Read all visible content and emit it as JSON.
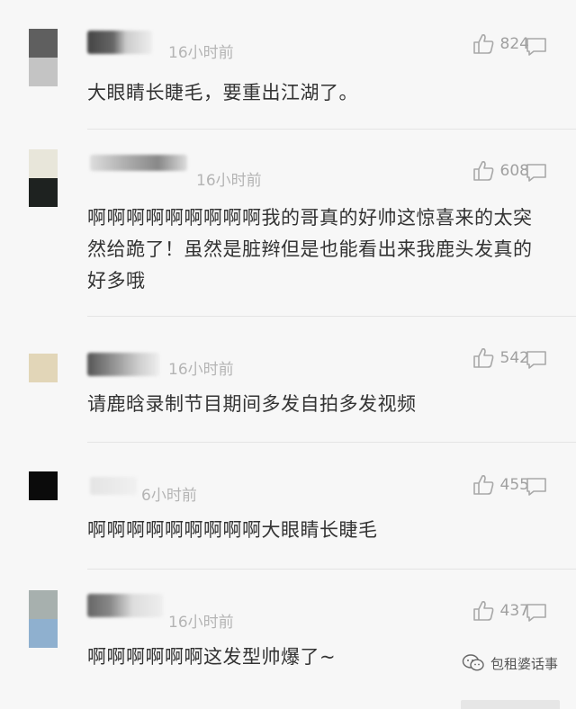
{
  "colors": {
    "text": "#333333",
    "meta": "#b4b4b4",
    "icon": "#a0a0a0",
    "divider": "#e4e4e4"
  },
  "comments": [
    {
      "time": "16小时前",
      "likes": "824",
      "text": "大眼睛长睫毛，要重出江湖了。",
      "avatar_colors": [
        "#5f5f5f",
        "#c4c4c4"
      ]
    },
    {
      "time": "16小时前",
      "likes": "608",
      "text": "啊啊啊啊啊啊啊啊啊我的哥真的好帅这惊喜来的太突然给跪了！虽然是脏辫但是也能看出来我鹿头发真的好多哦",
      "avatar_colors": [
        "#e8e6da",
        "#1e2220"
      ]
    },
    {
      "time": "16小时前",
      "likes": "542",
      "text": "请鹿晗录制节目期间多发自拍多发视频",
      "avatar_colors": [
        "#e2d6b8"
      ]
    },
    {
      "time": "6小时前",
      "likes": "455",
      "text": "啊啊啊啊啊啊啊啊啊大眼睛长睫毛",
      "avatar_colors": [
        "#0b0b0b"
      ]
    },
    {
      "time": "16小时前",
      "likes": "437",
      "text": "啊啊啊啊啊啊这发型帅爆了~",
      "avatar_colors": [
        "#a7b0ae",
        "#8fb0cf"
      ]
    }
  ],
  "watermark": {
    "text": "包租婆话事",
    "icon": "wechat-icon"
  }
}
